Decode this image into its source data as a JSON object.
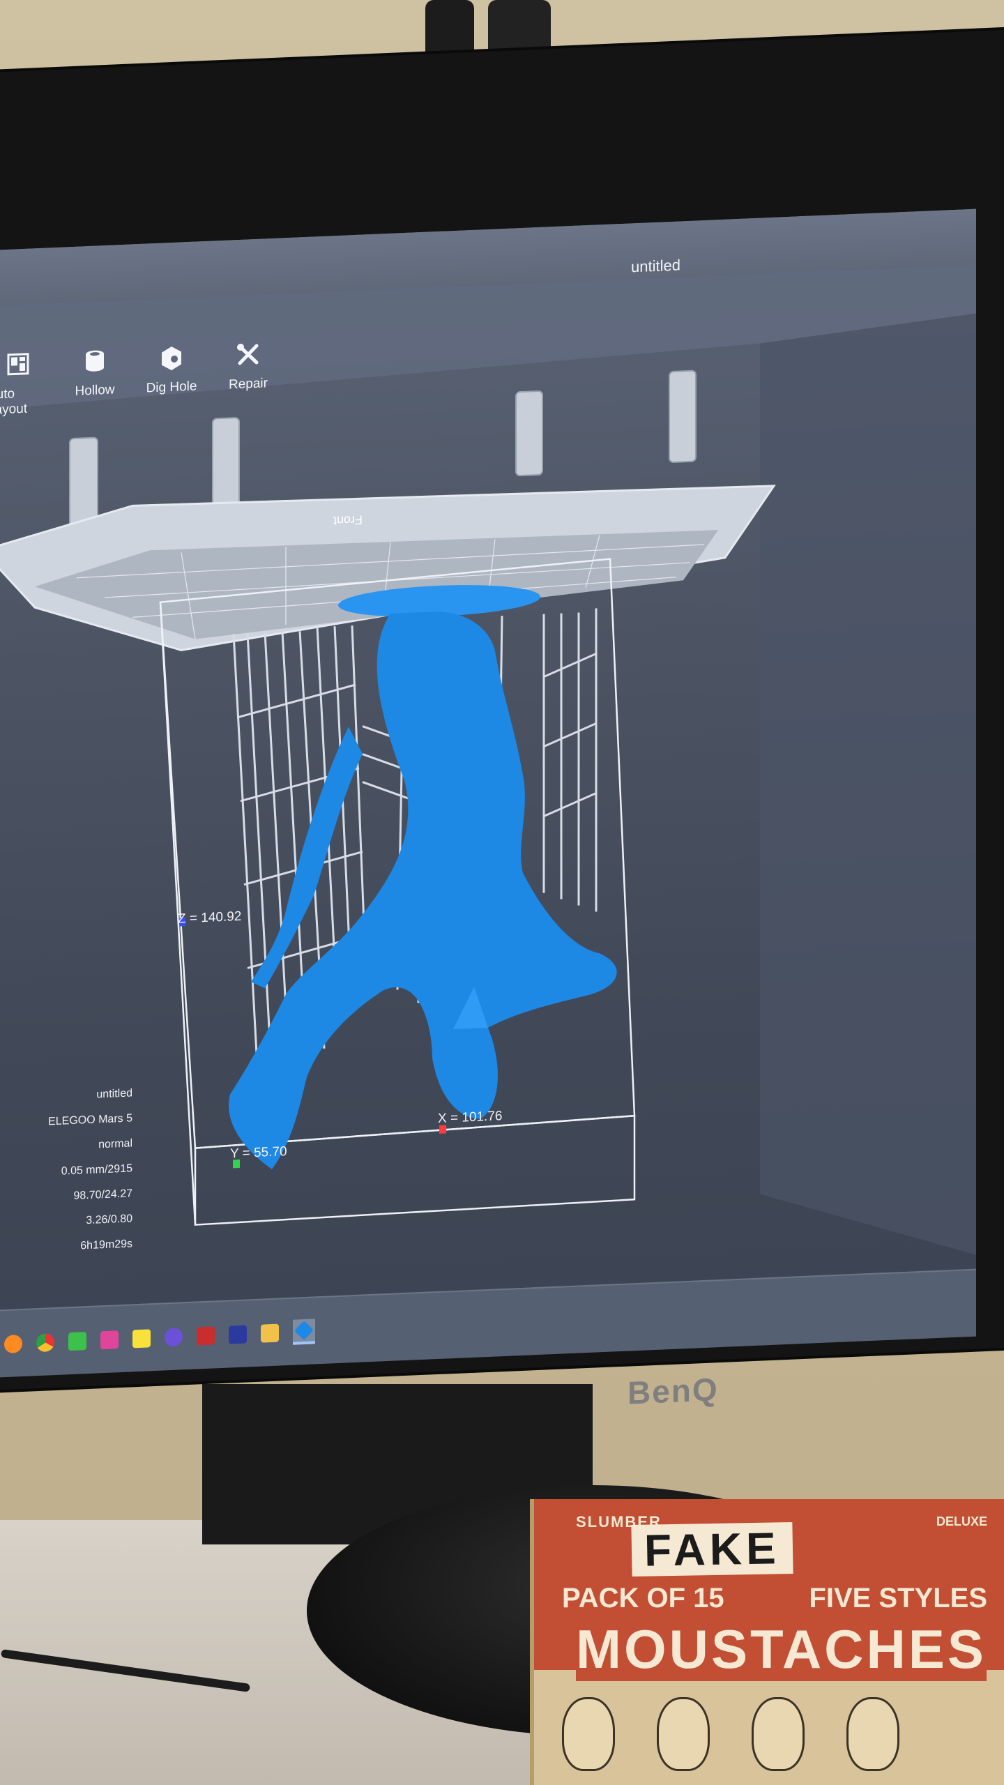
{
  "window": {
    "title": "untitled"
  },
  "toolbar": {
    "items": [
      {
        "label": "Auto Layout",
        "icon": "layout-icon"
      },
      {
        "label": "Hollow",
        "icon": "hollow-icon"
      },
      {
        "label": "Dig Hole",
        "icon": "dig-hole-icon"
      },
      {
        "label": "Repair",
        "icon": "repair-icon"
      }
    ]
  },
  "scene": {
    "plate_label": "Front",
    "dimensions": {
      "z": "Z = 140.92",
      "x": "X = 101.76",
      "y": "Y = 55.70"
    },
    "model_color": "#1e88e5",
    "support_color": "#d7dde6"
  },
  "info": {
    "name": "untitled",
    "printer": "ELEGOO Mars 5",
    "mode": "normal",
    "layer": "0.05 mm/2915",
    "volume": "98.70/24.27",
    "weight": "3.26/0.80",
    "time": "6h19m29s"
  },
  "taskbar": {
    "icons": [
      "explorer-icon",
      "firefox-icon",
      "chrome-icon",
      "media-player-icon",
      "calendar-icon",
      "notes-icon",
      "app-icon",
      "filezilla-icon",
      "audition-icon",
      "folder-icon",
      "chitubox-icon"
    ]
  },
  "bezel": {
    "brand": "BenQ"
  },
  "box": {
    "brand": "SLUMBER",
    "big": "FAKE",
    "left": "PACK OF 15",
    "right": "FIVE STYLES",
    "word": "MOUSTACHES",
    "dec": "DELUXE"
  }
}
